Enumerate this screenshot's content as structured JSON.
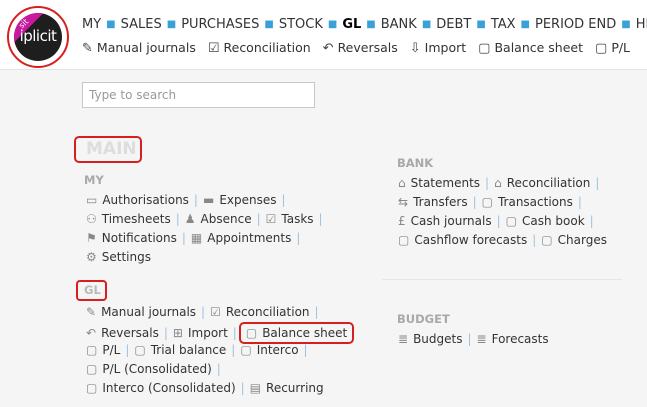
{
  "logo": {
    "ribbon": "sit",
    "brand": "iplicit"
  },
  "top_nav": [
    "MY",
    "SALES",
    "PURCHASES",
    "STOCK",
    "GL",
    "BANK",
    "DEBT",
    "TAX",
    "PERIOD END",
    "HR"
  ],
  "top_nav_active": "GL",
  "sub_nav": [
    {
      "label": "Manual journals",
      "icon": "journal-icon"
    },
    {
      "label": "Reconciliation",
      "icon": "checkbox-icon"
    },
    {
      "label": "Reversals",
      "icon": "reverse-arrow-icon"
    },
    {
      "label": "Import",
      "icon": "import-icon"
    },
    {
      "label": "Balance sheet",
      "icon": "book-icon"
    },
    {
      "label": "P/L",
      "icon": "book-icon"
    }
  ],
  "search": {
    "placeholder": "Type to search"
  },
  "main_title": "MAIN",
  "my": {
    "heading": "MY",
    "rows": [
      [
        {
          "label": "Authorisations",
          "icon": "chat-icon"
        },
        {
          "label": "Expenses",
          "icon": "card-icon"
        }
      ],
      [
        {
          "label": "Timesheets",
          "icon": "people-icon"
        },
        {
          "label": "Absence",
          "icon": "person-icon"
        },
        {
          "label": "Tasks",
          "icon": "task-icon"
        }
      ],
      [
        {
          "label": "Notifications",
          "icon": "flag-icon"
        },
        {
          "label": "Appointments",
          "icon": "calendar-icon"
        }
      ],
      [
        {
          "label": "Settings",
          "icon": "gear-icon"
        }
      ]
    ]
  },
  "gl": {
    "heading": "GL",
    "rows": [
      [
        {
          "label": "Manual journals",
          "icon": "journal-icon"
        },
        {
          "label": "Reconciliation",
          "icon": "checkbox-icon"
        }
      ],
      [
        {
          "label": "Reversals",
          "icon": "reverse-arrow-icon"
        },
        {
          "label": "Import",
          "icon": "import-icon"
        },
        {
          "label": "Balance sheet",
          "icon": "book-icon"
        }
      ],
      [
        {
          "label": "P/L",
          "icon": "book-icon"
        },
        {
          "label": "Trial balance",
          "icon": "book-icon"
        },
        {
          "label": "Interco",
          "icon": "book-icon"
        }
      ],
      [
        {
          "label": "P/L (Consolidated)",
          "icon": "book-icon"
        }
      ],
      [
        {
          "label": "Interco (Consolidated)",
          "icon": "book-icon"
        },
        {
          "label": "Recurring",
          "icon": "recurring-icon"
        }
      ]
    ]
  },
  "bank": {
    "heading": "BANK",
    "rows": [
      [
        {
          "label": "Statements",
          "icon": "bank-icon"
        },
        {
          "label": "Reconciliation",
          "icon": "bank-icon"
        }
      ],
      [
        {
          "label": "Transfers",
          "icon": "transfer-icon"
        },
        {
          "label": "Transactions",
          "icon": "book-icon"
        }
      ],
      [
        {
          "label": "Cash journals",
          "icon": "currency-icon"
        },
        {
          "label": "Cash book",
          "icon": "book-icon"
        }
      ],
      [
        {
          "label": "Cashflow forecasts",
          "icon": "book-icon"
        },
        {
          "label": "Charges",
          "icon": "book-icon"
        }
      ]
    ]
  },
  "budget": {
    "heading": "BUDGET",
    "rows": [
      [
        {
          "label": "Budgets",
          "icon": "list-icon"
        },
        {
          "label": "Forecasts",
          "icon": "list-icon"
        }
      ]
    ]
  }
}
